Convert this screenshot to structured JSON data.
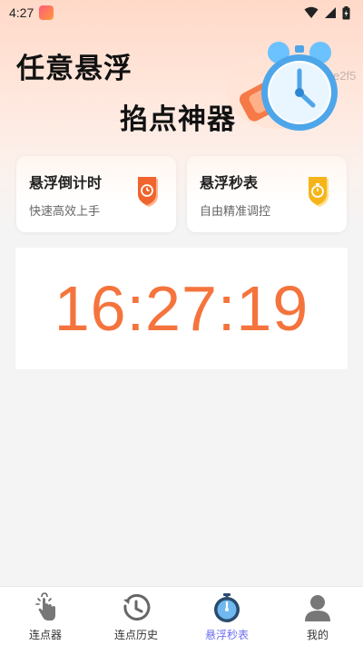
{
  "status_bar": {
    "time": "4:27"
  },
  "hero": {
    "title_line1": "任意悬浮",
    "title_line2": "掐点神器",
    "watermark_text": "e2f5"
  },
  "cards": [
    {
      "title": "悬浮倒计时",
      "subtitle": "快速高效上手",
      "icon": "countdown-shield-icon",
      "accent": "#f0642d"
    },
    {
      "title": "悬浮秒表",
      "subtitle": "自由精准调控",
      "icon": "stopwatch-shield-icon",
      "accent": "#f5b51a"
    }
  ],
  "clock": {
    "time": "16:27:19",
    "color": "#f5743d"
  },
  "bottom_nav": {
    "items": [
      {
        "label": "连点器",
        "icon": "tap-hand-icon",
        "active": false
      },
      {
        "label": "连点历史",
        "icon": "history-clock-icon",
        "active": false
      },
      {
        "label": "悬浮秒表",
        "icon": "stopwatch-icon",
        "active": true
      },
      {
        "label": "我的",
        "icon": "user-icon",
        "active": false
      }
    ],
    "active_color": "#6b6ef0"
  }
}
